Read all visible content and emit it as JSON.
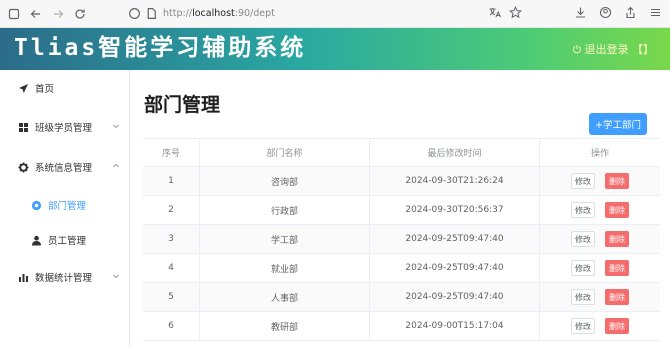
{
  "browser": {
    "url_prefix": "http://",
    "url_host": "localhost",
    "url_suffix": ":90/dept"
  },
  "header": {
    "app_title": "Tlias智能学习辅助系统",
    "logout_label": "退出登录 【】"
  },
  "sidebar": {
    "items": [
      {
        "label": "首页",
        "icon": "send-icon"
      },
      {
        "label": "班级学员管理",
        "icon": "grid-icon"
      },
      {
        "label": "系统信息管理",
        "icon": "gear-icon"
      },
      {
        "label": "部门管理",
        "icon": "settings-circle-icon"
      },
      {
        "label": "员工管理",
        "icon": "user-icon"
      },
      {
        "label": "数据统计管理",
        "icon": "bar-chart-icon"
      }
    ]
  },
  "main": {
    "page_title": "部门管理",
    "add_button": "+学工部门",
    "columns": [
      "序号",
      "部门名称",
      "最后修改时间",
      "操作"
    ],
    "rows": [
      {
        "no": "1",
        "name": "咨询部",
        "time": "2024-09-30T21:26:24"
      },
      {
        "no": "2",
        "name": "行政部",
        "time": "2024-09-30T20:56:37"
      },
      {
        "no": "3",
        "name": "学工部",
        "time": "2024-09-25T09:47:40"
      },
      {
        "no": "4",
        "name": "就业部",
        "time": "2024-09-25T09:47:40"
      },
      {
        "no": "5",
        "name": "人事部",
        "time": "2024-09-25T09:47:40"
      },
      {
        "no": "6",
        "name": "教研部",
        "time": "2024-09-00T15:17:04"
      }
    ],
    "edit_label": "修改",
    "delete_label": "删除"
  },
  "colors": {
    "accent": "#409eff",
    "danger": "#f56c6c",
    "header_gradient_start": "#2b6c8a",
    "header_gradient_end": "#7ad84a"
  }
}
